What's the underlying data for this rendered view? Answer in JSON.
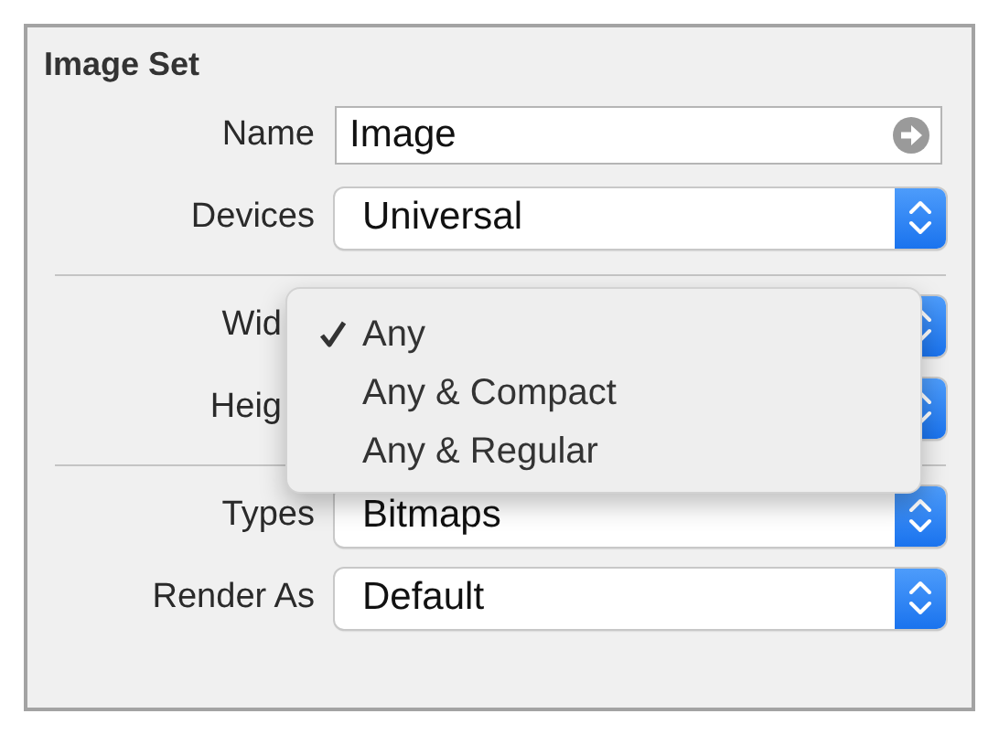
{
  "panel": {
    "title": "Image Set"
  },
  "sections": [
    {
      "rows": [
        {
          "kind": "field",
          "label": "Name",
          "value": "Image"
        },
        {
          "kind": "popup",
          "label": "Devices",
          "value": "Universal"
        }
      ]
    },
    {
      "rows": [
        {
          "kind": "covered",
          "label": "Wid"
        },
        {
          "kind": "covered",
          "label": "Heig"
        }
      ]
    },
    {
      "rows": [
        {
          "kind": "popup",
          "label": "Types",
          "value": "Bitmaps"
        },
        {
          "kind": "popup",
          "label": "Render As",
          "value": "Default"
        }
      ]
    }
  ],
  "menu": {
    "items": [
      {
        "label": "Any",
        "selected": true
      },
      {
        "label": "Any & Compact",
        "selected": false
      },
      {
        "label": "Any & Regular",
        "selected": false
      }
    ]
  }
}
